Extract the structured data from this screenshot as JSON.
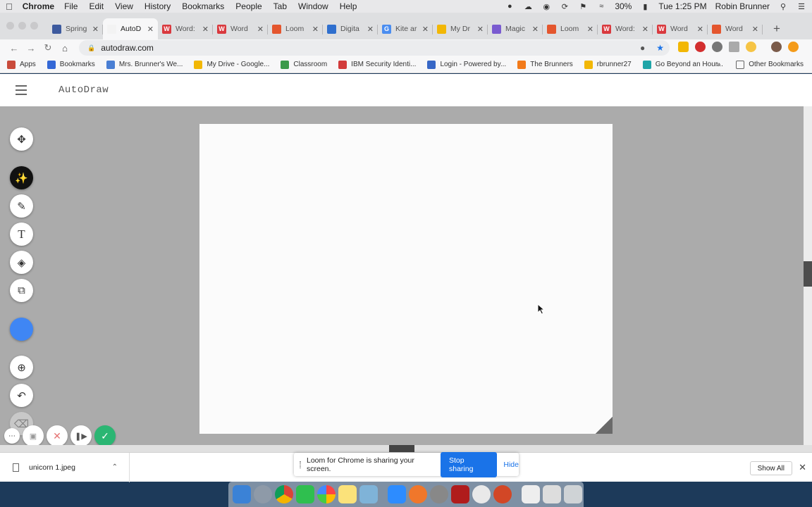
{
  "menubar": {
    "app": "Chrome",
    "items": [
      "File",
      "Edit",
      "View",
      "History",
      "Bookmarks",
      "People",
      "Tab",
      "Window",
      "Help"
    ],
    "battery": "30%",
    "clock": "Tue 1:25 PM",
    "user": "Robin Brunner"
  },
  "tabs": [
    {
      "title": "Spring",
      "color": "#3d5a9e",
      "glyph": ""
    },
    {
      "title": "AutoD",
      "color": "#f3f3f3",
      "glyph": ""
    },
    {
      "title": "Word:",
      "color": "#d9393e",
      "glyph": "W"
    },
    {
      "title": "Word",
      "color": "#d9393e",
      "glyph": "W"
    },
    {
      "title": "Loom",
      "color": "#e4562e",
      "glyph": ""
    },
    {
      "title": "Digita",
      "color": "#2f6fce",
      "glyph": ""
    },
    {
      "title": "Kite ar",
      "color": "#4a8df0",
      "glyph": "G"
    },
    {
      "title": "My Dr",
      "color": "#f2b705",
      "glyph": ""
    },
    {
      "title": "Magic",
      "color": "#7a5bd0",
      "glyph": ""
    },
    {
      "title": "Loom",
      "color": "#e4562e",
      "glyph": ""
    },
    {
      "title": "Word:",
      "color": "#d9393e",
      "glyph": "W"
    },
    {
      "title": "Word",
      "color": "#d9393e",
      "glyph": "W"
    },
    {
      "title": "Word",
      "color": "#e4562e",
      "glyph": ""
    }
  ],
  "address": "autodraw.com",
  "bookmarks": [
    {
      "label": "Apps",
      "color": "#c94b3b"
    },
    {
      "label": "Bookmarks",
      "color": "#3468d6"
    },
    {
      "label": "Mrs. Brunner's We...",
      "color": "#4a7fd4"
    },
    {
      "label": "My Drive - Google...",
      "color": "#f2b705"
    },
    {
      "label": "Classroom",
      "color": "#3b9a4a"
    },
    {
      "label": "IBM Security Identi...",
      "color": "#d23b3b"
    },
    {
      "label": "Login - Powered by...",
      "color": "#3767c6"
    },
    {
      "label": "The Brunners",
      "color": "#f27a1a"
    },
    {
      "label": "rbrunner27",
      "color": "#f2b705"
    },
    {
      "label": "Go Beyond an Hour...",
      "color": "#1fa5a8"
    }
  ],
  "bookmarks_more": "»",
  "other_bookmarks": "Other Bookmarks",
  "app": {
    "title": "AutoDraw",
    "color_swatch": "#3f86f4"
  },
  "downloads": {
    "file": "unicorn 1.jpeg",
    "show_all": "Show All"
  },
  "sharing": {
    "message": "Loom for Chrome is sharing your screen.",
    "stop": "Stop sharing",
    "hide": "Hide"
  }
}
